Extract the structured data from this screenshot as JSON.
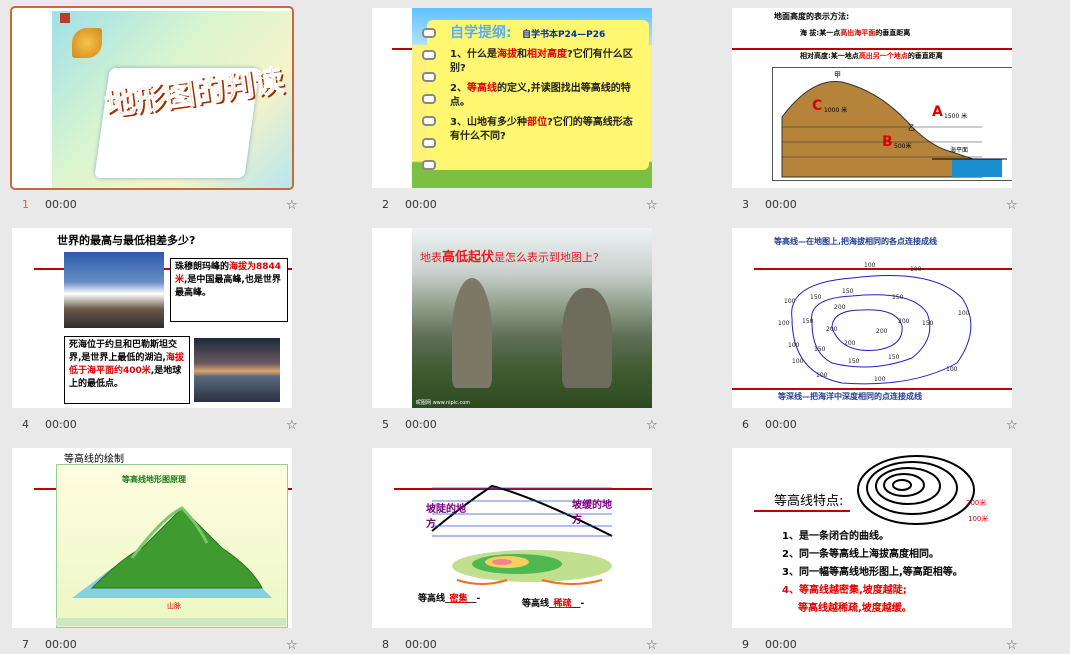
{
  "slides": [
    {
      "num": "1",
      "time": "00:00",
      "title": "地形图的判读"
    },
    {
      "num": "2",
      "time": "00:00",
      "heading": "自学提纲:",
      "book": "自学书本P24—P26",
      "items": [
        {
          "pre": "1、什么是",
          "r1": "海拔",
          "mid": "和",
          "r2": "相对高度",
          "post": "?它们有什么区别?"
        },
        {
          "pre": "2、",
          "r1": "等高线",
          "mid": "",
          "r2": "",
          "post": "的定义,并读图找出等高线的特点。"
        },
        {
          "pre": "3、山地有多少种",
          "r1": "部位",
          "mid": "",
          "r2": "",
          "post": "?它们的等高线形态有什么不同?"
        }
      ]
    },
    {
      "num": "3",
      "time": "00:00",
      "title": "地面高度的表示方法:",
      "line1a": "海    拔:某一点",
      "line1b": "高出海平面",
      "line1c": "的垂直距离",
      "line2a": "相对高度:某一地点",
      "line2b": "高出另一个地点",
      "line2c": "的垂直距离",
      "jia": "甲",
      "yi": "乙",
      "a": "A",
      "b": "B",
      "c": "C",
      "h1": "1500 米",
      "h2": "500米",
      "h3": "1000 米",
      "sea": "海平面"
    },
    {
      "num": "4",
      "time": "00:00",
      "question": "世界的最高与最低相差多少?",
      "p1a": "珠穆朗玛峰的",
      "p1b": "海拔为8844米",
      "p1c": ",是中国最高峰,也是世界最高峰。",
      "p2a": "死海位于约旦和巴勒斯坦交界,是世界上最低的湖泊,",
      "p2b": "海拔低于海平面约400米",
      "p2c": ",是地球上的最低点。"
    },
    {
      "num": "5",
      "time": "00:00",
      "t1": "地表",
      "t2": "高低起伏",
      "t3": "是怎么表示到地图上?",
      "credit": "昵图网 www.nipic.com"
    },
    {
      "num": "6",
      "time": "00:00",
      "top": "等高线—在地图上,把海拔相同的各点连接成线",
      "bottom": "等深线—把海洋中深度相同的点连接成线",
      "labels": [
        "100",
        "100",
        "100",
        "100",
        "100",
        "100",
        "100",
        "100",
        "100",
        "100",
        "150",
        "150",
        "150",
        "150",
        "150",
        "150",
        "150",
        "150",
        "200",
        "200",
        "200",
        "200",
        "200"
      ]
    },
    {
      "num": "7",
      "time": "00:00",
      "label": "等高线的绘制",
      "inner_title": "等高线地形图原理",
      "mountain": "山脉"
    },
    {
      "num": "8",
      "time": "00:00",
      "steep": "坡陡的地方",
      "gentle": "坡缓的地方",
      "b1a": "等高线",
      "b1b": "密集",
      "b2a": "等高线",
      "b2b": "稀疏"
    },
    {
      "num": "9",
      "time": "00:00",
      "title": "等高线特点:",
      "h200": "200米",
      "h100": "100米",
      "f1": "1、是一条闭合的曲线。",
      "f2": "2、同一条等高线上海拔高度相同。",
      "f3": "3、同一幅等高线地形图上,等高距相等。",
      "f4": "4、等高线越密集,坡度越陡;",
      "f5": "等高线越稀疏,坡度越缓。"
    }
  ],
  "colors": {
    "accent": "#c8693a",
    "red": "#c00000"
  },
  "icons": {
    "star": "star-outline-icon"
  }
}
